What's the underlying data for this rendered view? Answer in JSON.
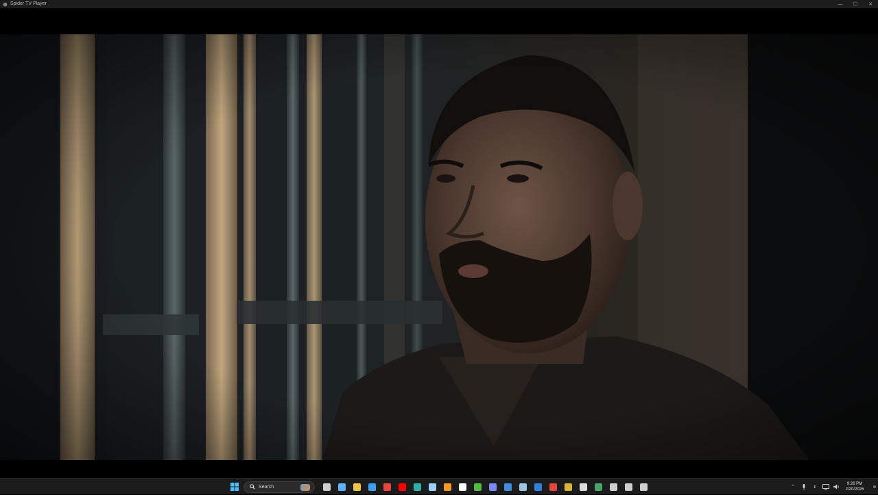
{
  "window": {
    "title": "Spider TV Player",
    "minimize_glyph": "—",
    "maximize_glyph": "☐",
    "close_glyph": "✕"
  },
  "video": {
    "scene": "video-frame"
  },
  "taskbar": {
    "search_label": "Search",
    "pinned_icons": [
      {
        "name": "task-view-icon",
        "color": "#cfcfcf"
      },
      {
        "name": "copilot-icon",
        "color": "#5fb0ff"
      },
      {
        "name": "file-explorer-icon",
        "color": "#f3c443"
      },
      {
        "name": "microsoft-store-icon",
        "color": "#3aa0f3"
      },
      {
        "name": "chrome-icon",
        "color": "#e8453c"
      },
      {
        "name": "youtube-icon",
        "color": "#ff0000"
      },
      {
        "name": "edge-icon",
        "color": "#27b3a6"
      },
      {
        "name": "active-app-icon",
        "color": "#9ad0ff"
      },
      {
        "name": "orange-app-icon",
        "color": "#f59a23"
      },
      {
        "name": "tiktok-icon",
        "color": "#ffffff"
      },
      {
        "name": "xbox-icon",
        "color": "#4fbb3f"
      },
      {
        "name": "discord-icon",
        "color": "#7b89f5"
      },
      {
        "name": "mail-icon",
        "color": "#3c8de0"
      },
      {
        "name": "steam-icon",
        "color": "#9cc6e8"
      },
      {
        "name": "blue-app-icon",
        "color": "#2f7fe0"
      },
      {
        "name": "red-app-icon",
        "color": "#e8453c"
      },
      {
        "name": "yellow-app-icon",
        "color": "#d9b532"
      },
      {
        "name": "spider-tv-icon",
        "color": "#dddddd"
      },
      {
        "name": "terminal-icon",
        "color": "#4aa56a"
      },
      {
        "name": "controller-icon",
        "color": "#cfcfcf"
      },
      {
        "name": "task-manager-icon",
        "color": "#cfcfcf"
      },
      {
        "name": "extra-app-icon",
        "color": "#cfcfcf"
      }
    ],
    "tray": {
      "chevron_glyph": "⌃",
      "mic_glyph": "🎙",
      "language": "ε",
      "network_glyph": "▭",
      "volume_glyph": "🔊",
      "battery_glyph": "▮"
    },
    "clock": {
      "time": "9:26 PM",
      "date": "2/20/2026"
    }
  }
}
